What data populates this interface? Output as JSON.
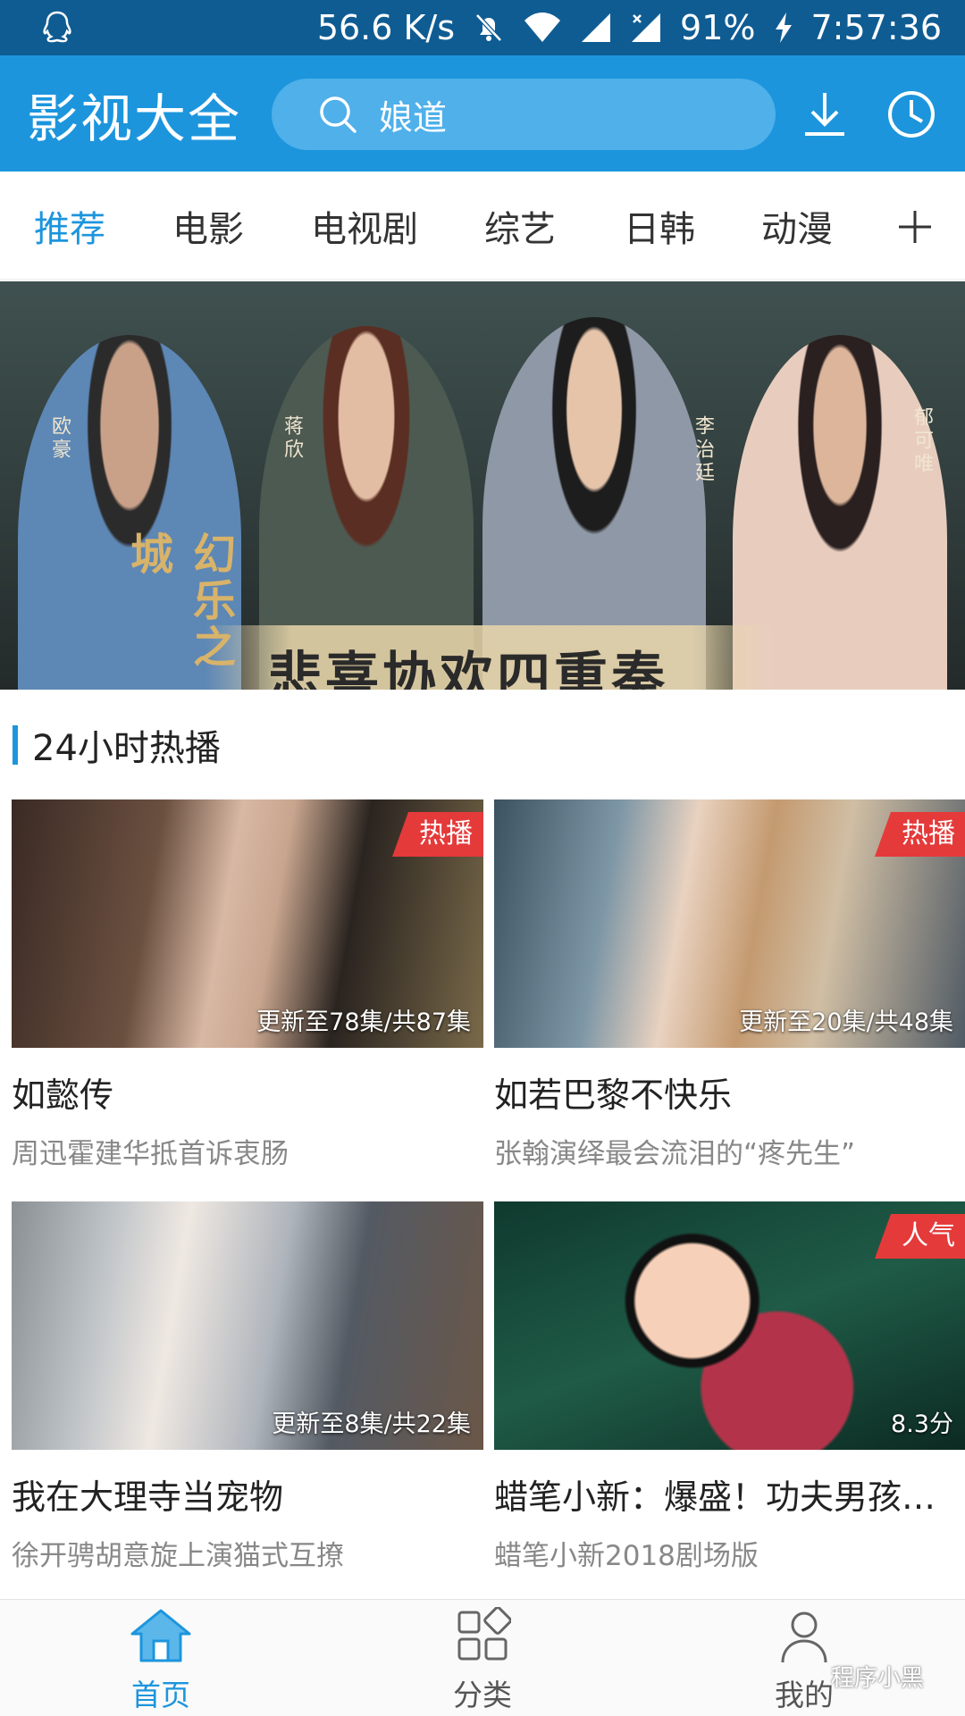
{
  "status_bar": {
    "speed": "56.6 K/s",
    "battery": "91%",
    "time": "7:57:36"
  },
  "header": {
    "logo": "影视大全",
    "search_text": "娘道"
  },
  "tabs": [
    {
      "label": "推荐",
      "active": true
    },
    {
      "label": "电影"
    },
    {
      "label": "电视剧"
    },
    {
      "label": "综艺"
    },
    {
      "label": "日韩"
    },
    {
      "label": "动漫"
    }
  ],
  "banner": {
    "title": "悲喜协欢四重奏",
    "cast": [
      "欧豪",
      "蒋欣",
      "李治廷",
      "郁可唯"
    ],
    "logo": "幻乐之城"
  },
  "section": {
    "title": "24小时热播"
  },
  "cards": [
    {
      "badge": "热播",
      "episodes": "更新至78集/共87集",
      "title": "如懿传",
      "subtitle": "周迅霍建华抵首诉衷肠"
    },
    {
      "badge": "热播",
      "episodes": "更新至20集/共48集",
      "title": "如若巴黎不快乐",
      "subtitle": "张翰演绎最会流泪的“疼先生”"
    },
    {
      "badge": "",
      "episodes": "更新至8集/共22集",
      "title": "我在大理寺当宠物",
      "subtitle": "徐开骋胡意旋上演猫式互撩"
    },
    {
      "badge": "人气",
      "episodes": "8.3分",
      "title": "蜡笔小新：爆盛！功夫男孩～…",
      "subtitle": "蜡笔小新2018剧场版"
    }
  ],
  "bottom_nav": [
    {
      "label": "首页",
      "icon": "home-icon",
      "active": true
    },
    {
      "label": "分类",
      "icon": "category-icon"
    },
    {
      "label": "我的",
      "icon": "profile-icon"
    }
  ],
  "watermark": "程序小黑",
  "colors": {
    "header_blue": "#1c95dd",
    "status_bar": "#0f5c93",
    "badge_red": "#e53a3a"
  }
}
